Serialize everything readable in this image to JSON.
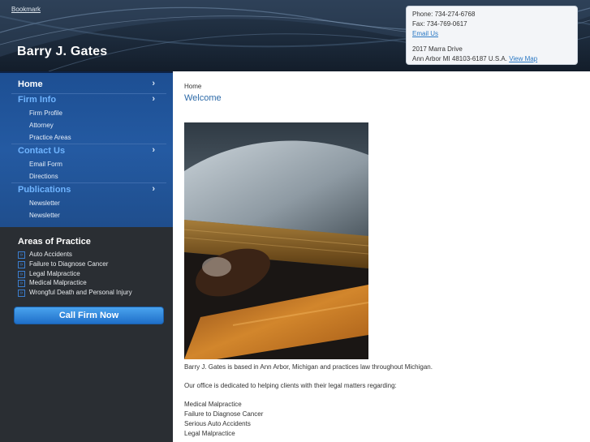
{
  "header": {
    "bookmark": "Bookmark",
    "title": "Barry J. Gates"
  },
  "contact": {
    "phone": "Phone: 734-274-6768",
    "fax": "Fax: 734-769-0617",
    "email_link": "Email Us",
    "street": "2017 Marra Drive",
    "city": "Ann Arbor MI 48103-6187 U.S.A.",
    "map_link": "View Map"
  },
  "nav": {
    "home": "Home",
    "firm_info": "Firm Info",
    "firm_profile": "Firm Profile",
    "attorney": "Attorney",
    "practice_areas": "Practice Areas",
    "contact_us": "Contact Us",
    "email_form": "Email Form",
    "directions": "Directions",
    "publications": "Publications",
    "newsletter_1": "Newsletter",
    "newsletter_2": "Newsletter",
    "chevron": "›"
  },
  "areas": {
    "title": "Areas of Practice",
    "items": [
      "Auto Accidents",
      "Failure to Diagnose Cancer",
      "Legal Malpractice",
      "Medical Malpractice",
      "Wrongful Death and Personal Injury"
    ],
    "bullet": "»"
  },
  "call_button": "Call Firm Now",
  "main": {
    "breadcrumb": "Home",
    "title": "Welcome",
    "para1": "Barry J. Gates is based in Ann Arbor, Michigan and practices law throughout Michigan.",
    "para2": "Our office is dedicated to helping clients with their legal matters regarding:",
    "list": [
      "Medical Malpractice",
      "Failure to Diagnose Cancer",
      "Serious Auto Accidents",
      "Legal Malpractice"
    ]
  }
}
